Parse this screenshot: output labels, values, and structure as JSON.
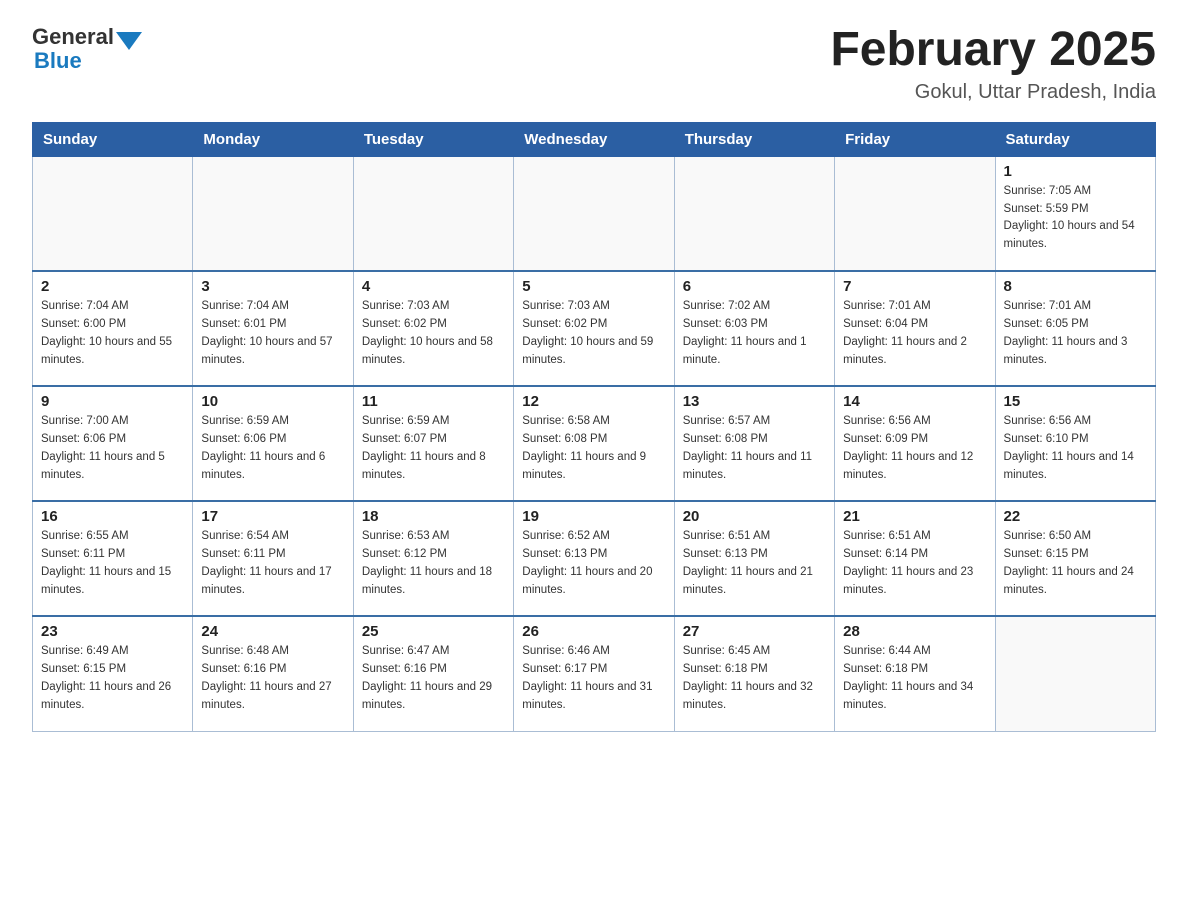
{
  "header": {
    "logo_general": "General",
    "logo_blue": "Blue",
    "title": "February 2025",
    "subtitle": "Gokul, Uttar Pradesh, India"
  },
  "weekdays": [
    "Sunday",
    "Monday",
    "Tuesday",
    "Wednesday",
    "Thursday",
    "Friday",
    "Saturday"
  ],
  "weeks": [
    [
      {
        "day": "",
        "sunrise": "",
        "sunset": "",
        "daylight": ""
      },
      {
        "day": "",
        "sunrise": "",
        "sunset": "",
        "daylight": ""
      },
      {
        "day": "",
        "sunrise": "",
        "sunset": "",
        "daylight": ""
      },
      {
        "day": "",
        "sunrise": "",
        "sunset": "",
        "daylight": ""
      },
      {
        "day": "",
        "sunrise": "",
        "sunset": "",
        "daylight": ""
      },
      {
        "day": "",
        "sunrise": "",
        "sunset": "",
        "daylight": ""
      },
      {
        "day": "1",
        "sunrise": "Sunrise: 7:05 AM",
        "sunset": "Sunset: 5:59 PM",
        "daylight": "Daylight: 10 hours and 54 minutes."
      }
    ],
    [
      {
        "day": "2",
        "sunrise": "Sunrise: 7:04 AM",
        "sunset": "Sunset: 6:00 PM",
        "daylight": "Daylight: 10 hours and 55 minutes."
      },
      {
        "day": "3",
        "sunrise": "Sunrise: 7:04 AM",
        "sunset": "Sunset: 6:01 PM",
        "daylight": "Daylight: 10 hours and 57 minutes."
      },
      {
        "day": "4",
        "sunrise": "Sunrise: 7:03 AM",
        "sunset": "Sunset: 6:02 PM",
        "daylight": "Daylight: 10 hours and 58 minutes."
      },
      {
        "day": "5",
        "sunrise": "Sunrise: 7:03 AM",
        "sunset": "Sunset: 6:02 PM",
        "daylight": "Daylight: 10 hours and 59 minutes."
      },
      {
        "day": "6",
        "sunrise": "Sunrise: 7:02 AM",
        "sunset": "Sunset: 6:03 PM",
        "daylight": "Daylight: 11 hours and 1 minute."
      },
      {
        "day": "7",
        "sunrise": "Sunrise: 7:01 AM",
        "sunset": "Sunset: 6:04 PM",
        "daylight": "Daylight: 11 hours and 2 minutes."
      },
      {
        "day": "8",
        "sunrise": "Sunrise: 7:01 AM",
        "sunset": "Sunset: 6:05 PM",
        "daylight": "Daylight: 11 hours and 3 minutes."
      }
    ],
    [
      {
        "day": "9",
        "sunrise": "Sunrise: 7:00 AM",
        "sunset": "Sunset: 6:06 PM",
        "daylight": "Daylight: 11 hours and 5 minutes."
      },
      {
        "day": "10",
        "sunrise": "Sunrise: 6:59 AM",
        "sunset": "Sunset: 6:06 PM",
        "daylight": "Daylight: 11 hours and 6 minutes."
      },
      {
        "day": "11",
        "sunrise": "Sunrise: 6:59 AM",
        "sunset": "Sunset: 6:07 PM",
        "daylight": "Daylight: 11 hours and 8 minutes."
      },
      {
        "day": "12",
        "sunrise": "Sunrise: 6:58 AM",
        "sunset": "Sunset: 6:08 PM",
        "daylight": "Daylight: 11 hours and 9 minutes."
      },
      {
        "day": "13",
        "sunrise": "Sunrise: 6:57 AM",
        "sunset": "Sunset: 6:08 PM",
        "daylight": "Daylight: 11 hours and 11 minutes."
      },
      {
        "day": "14",
        "sunrise": "Sunrise: 6:56 AM",
        "sunset": "Sunset: 6:09 PM",
        "daylight": "Daylight: 11 hours and 12 minutes."
      },
      {
        "day": "15",
        "sunrise": "Sunrise: 6:56 AM",
        "sunset": "Sunset: 6:10 PM",
        "daylight": "Daylight: 11 hours and 14 minutes."
      }
    ],
    [
      {
        "day": "16",
        "sunrise": "Sunrise: 6:55 AM",
        "sunset": "Sunset: 6:11 PM",
        "daylight": "Daylight: 11 hours and 15 minutes."
      },
      {
        "day": "17",
        "sunrise": "Sunrise: 6:54 AM",
        "sunset": "Sunset: 6:11 PM",
        "daylight": "Daylight: 11 hours and 17 minutes."
      },
      {
        "day": "18",
        "sunrise": "Sunrise: 6:53 AM",
        "sunset": "Sunset: 6:12 PM",
        "daylight": "Daylight: 11 hours and 18 minutes."
      },
      {
        "day": "19",
        "sunrise": "Sunrise: 6:52 AM",
        "sunset": "Sunset: 6:13 PM",
        "daylight": "Daylight: 11 hours and 20 minutes."
      },
      {
        "day": "20",
        "sunrise": "Sunrise: 6:51 AM",
        "sunset": "Sunset: 6:13 PM",
        "daylight": "Daylight: 11 hours and 21 minutes."
      },
      {
        "day": "21",
        "sunrise": "Sunrise: 6:51 AM",
        "sunset": "Sunset: 6:14 PM",
        "daylight": "Daylight: 11 hours and 23 minutes."
      },
      {
        "day": "22",
        "sunrise": "Sunrise: 6:50 AM",
        "sunset": "Sunset: 6:15 PM",
        "daylight": "Daylight: 11 hours and 24 minutes."
      }
    ],
    [
      {
        "day": "23",
        "sunrise": "Sunrise: 6:49 AM",
        "sunset": "Sunset: 6:15 PM",
        "daylight": "Daylight: 11 hours and 26 minutes."
      },
      {
        "day": "24",
        "sunrise": "Sunrise: 6:48 AM",
        "sunset": "Sunset: 6:16 PM",
        "daylight": "Daylight: 11 hours and 27 minutes."
      },
      {
        "day": "25",
        "sunrise": "Sunrise: 6:47 AM",
        "sunset": "Sunset: 6:16 PM",
        "daylight": "Daylight: 11 hours and 29 minutes."
      },
      {
        "day": "26",
        "sunrise": "Sunrise: 6:46 AM",
        "sunset": "Sunset: 6:17 PM",
        "daylight": "Daylight: 11 hours and 31 minutes."
      },
      {
        "day": "27",
        "sunrise": "Sunrise: 6:45 AM",
        "sunset": "Sunset: 6:18 PM",
        "daylight": "Daylight: 11 hours and 32 minutes."
      },
      {
        "day": "28",
        "sunrise": "Sunrise: 6:44 AM",
        "sunset": "Sunset: 6:18 PM",
        "daylight": "Daylight: 11 hours and 34 minutes."
      },
      {
        "day": "",
        "sunrise": "",
        "sunset": "",
        "daylight": ""
      }
    ]
  ]
}
